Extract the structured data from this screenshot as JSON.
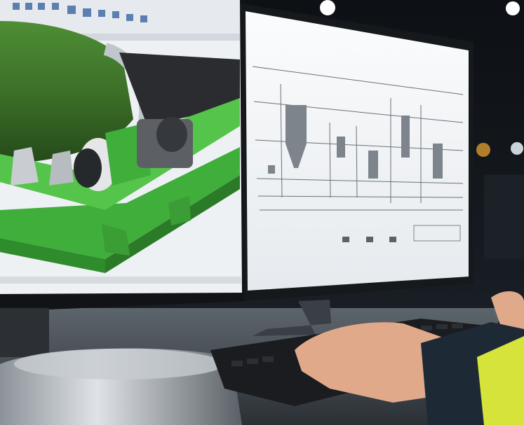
{
  "scene": {
    "description_label": "",
    "left_monitor": {
      "app": "cad-3d-model",
      "model_colors": {
        "frame": "#3fae3a",
        "drum": "#3e7a2c",
        "shaft": "#d8d8d8",
        "motor": "#6b6e72"
      }
    },
    "right_monitor": {
      "app": "process-flow-diagram",
      "section_labels": [
        "",
        "",
        ""
      ]
    },
    "colors": {
      "background": "#0f1317",
      "screen_bg": "#f3f5f8",
      "bezel": "#121417",
      "desk": "#4a5157",
      "sleeve": "#1d2a36",
      "hi_vis": "#d6e33a",
      "skin": "#e0a98a"
    }
  }
}
